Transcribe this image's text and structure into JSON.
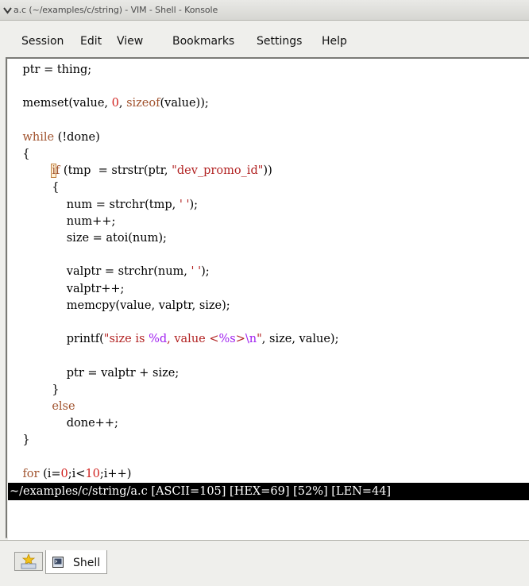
{
  "window": {
    "title": "a.c (~/examples/c/string) - VIM - Shell - Konsole"
  },
  "menu": [
    "Session",
    "Edit",
    "View",
    "Bookmarks",
    "Settings",
    "Help"
  ],
  "code": [
    "    ptr = thing;",
    "",
    "    memset(value, 0, sizeof(value));",
    "",
    "    while (!done)",
    "    {",
    "            if (tmp  = strstr(ptr, \"dev_promo_id\"))",
    "            {",
    "                num = strchr(tmp, ' ');",
    "                num++;",
    "                size = atoi(num);",
    "",
    "                valptr = strchr(num, ' ');",
    "                valptr++;",
    "                memcpy(value, valptr, size);",
    "",
    "                printf(\"size is %d, value <%s>\\n\", size, value);",
    "",
    "                ptr = valptr + size;",
    "            }",
    "            else",
    "                done++;",
    "    }",
    "",
    "    for (i=0;i<10;i++)"
  ],
  "status_line": "~/examples/c/string/a.c [ASCII=105] [HEX=69] [52%] [LEN=44]",
  "tabs": [
    {
      "label": "Shell",
      "icon": "terminal-icon"
    }
  ],
  "new_tab_icon": "new-session-icon",
  "colors": {
    "keyword": "#a0522d",
    "number": "#d0201d",
    "string": "#b22222",
    "escape": "#a020f0",
    "status_bg": "#000000",
    "status_fg": "#ffffff"
  }
}
